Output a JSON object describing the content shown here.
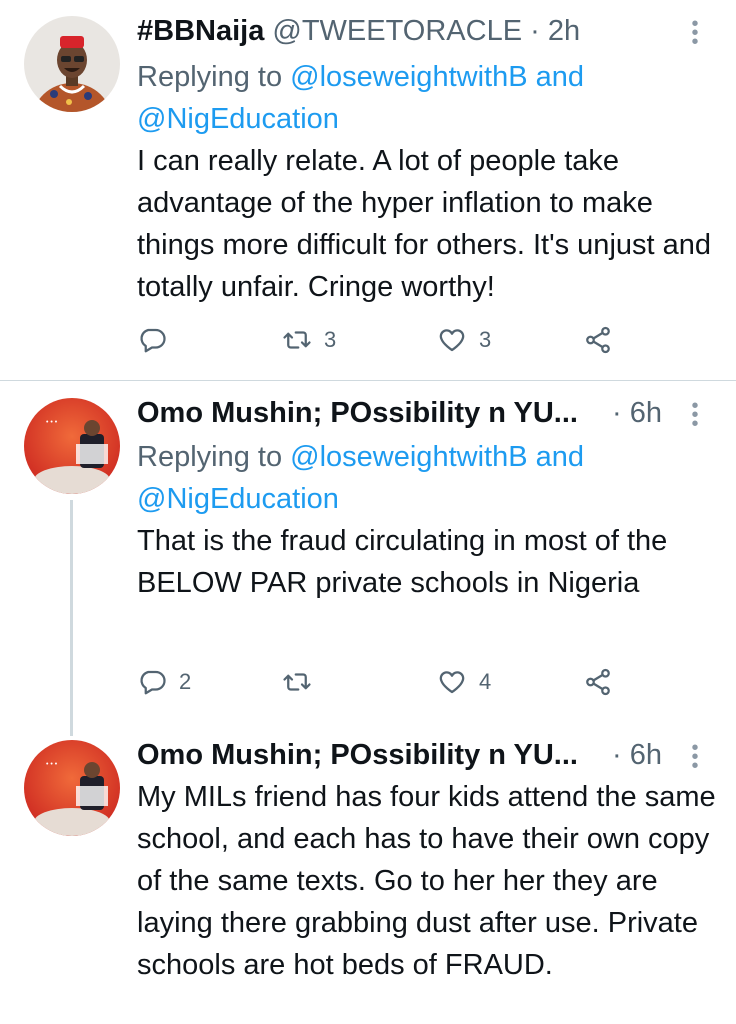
{
  "tweets": [
    {
      "name": "#BBNaija",
      "handle_time": "@TWEETORACLE · 2h",
      "replying_prefix": "Replying to ",
      "reply_user1": "@loseweightwithB",
      "reply_and": " and",
      "reply_user2": "@NigEducation",
      "text": "I can really relate. A lot of people take advantage of the hyper inflation to make things more difficult for others. It's unjust and totally unfair. Cringe worthy!",
      "reply_count": "",
      "retweet_count": "3",
      "like_count": "3"
    },
    {
      "name": "Omo Mushin; POssibility n YU...",
      "handle_time": "· 6h",
      "replying_prefix": "Replying to ",
      "reply_user1": "@loseweightwithB",
      "reply_and": " and",
      "reply_user2": "@NigEducation",
      "text": "That is the fraud circulating in most of the BELOW PAR private schools in Nigeria",
      "reply_count": "2",
      "retweet_count": "",
      "like_count": "4"
    },
    {
      "name": "Omo Mushin; POssibility n YU...",
      "handle_time": "· 6h",
      "text": "My MILs friend has four kids attend the same school, and each has to have their own copy of the same texts. Go to her her they are laying there grabbing dust after use. Private schools are hot beds of FRAUD."
    }
  ],
  "icons": {
    "reply": "reply-icon",
    "retweet": "retweet-icon",
    "like": "heart-icon",
    "share": "share-icon",
    "more": "more-icon"
  },
  "colors": {
    "link": "#1d9bf0",
    "meta": "#536471",
    "text": "#0f1419",
    "divider": "#cfd9de"
  }
}
